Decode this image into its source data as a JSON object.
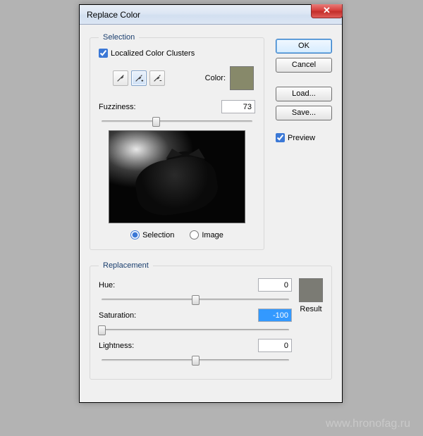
{
  "window": {
    "title": "Replace Color"
  },
  "buttons": {
    "ok": "OK",
    "cancel": "Cancel",
    "load": "Load...",
    "save": "Save...",
    "preview": "Preview"
  },
  "selection": {
    "legend": "Selection",
    "localized_label": "Localized Color Clusters",
    "color_label": "Color:",
    "color_hex": "#87896a",
    "fuzziness_label": "Fuzziness:",
    "fuzziness_value": "73",
    "fuzziness_pct": 36,
    "radio_selection": "Selection",
    "radio_image": "Image"
  },
  "replacement": {
    "legend": "Replacement",
    "hue_label": "Hue:",
    "hue_value": "0",
    "hue_pct": 50,
    "sat_label": "Saturation:",
    "sat_value": "-100",
    "sat_pct": 0,
    "light_label": "Lightness:",
    "light_value": "0",
    "light_pct": 50,
    "result_label": "Result",
    "result_hex": "#7b7b74"
  },
  "watermark": "www.hronofag.ru"
}
